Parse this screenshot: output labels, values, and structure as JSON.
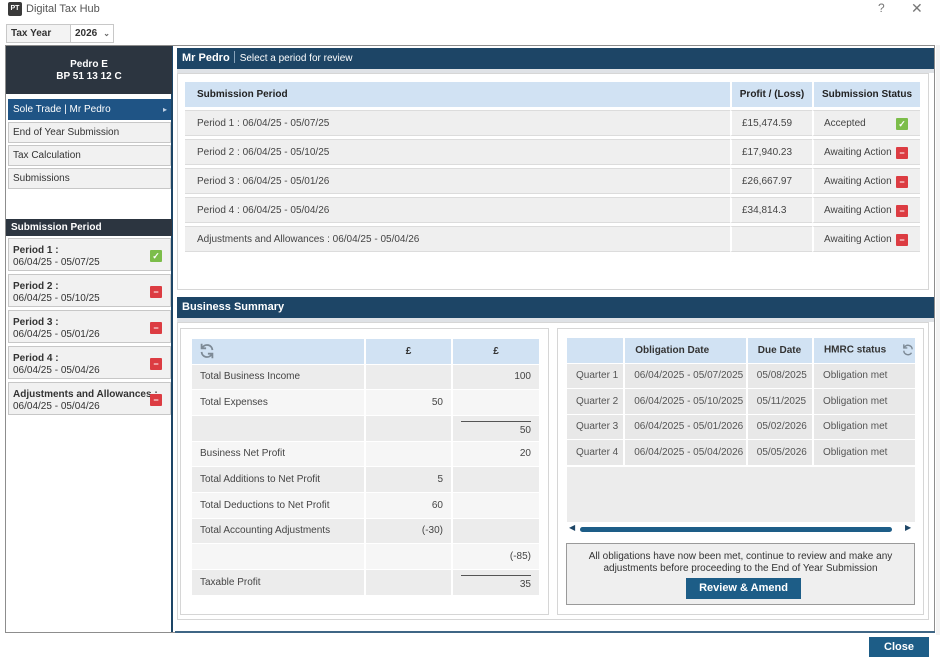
{
  "window": {
    "logo_text": "PT",
    "title": "Digital Tax Hub",
    "help": "?",
    "close": "✕"
  },
  "tax_year": {
    "label": "Tax Year",
    "value": "2026"
  },
  "client": {
    "name": "Pedro E",
    "ref": "BP 51 13 12 C"
  },
  "nav": [
    {
      "label": "Sole Trade | Mr Pedro",
      "active": true
    },
    {
      "label": "End of Year Submission"
    },
    {
      "label": "Tax Calculation"
    },
    {
      "label": "Submissions"
    }
  ],
  "side_periods": {
    "title": "Submission Period",
    "items": [
      {
        "name": "Period 1 :",
        "dates": "06/04/25  -  05/07/25",
        "status": "ok"
      },
      {
        "name": "Period 2 :",
        "dates": "06/04/25  -  05/10/25",
        "status": "no"
      },
      {
        "name": "Period 3 :",
        "dates": "06/04/25  -  05/01/26",
        "status": "no"
      },
      {
        "name": "Period 4 :",
        "dates": "06/04/25  -  05/04/26",
        "status": "no"
      },
      {
        "name": "Adjustments and Allowances :",
        "dates": "06/04/25  -  05/04/26",
        "status": "no"
      }
    ]
  },
  "header": {
    "name": "Mr Pedro",
    "subtitle": "Select a period for review"
  },
  "submissions": {
    "columns": [
      "Submission Period",
      "Profit / (Loss)",
      "Submission Status"
    ],
    "rows": [
      {
        "period": "Period 1 :  06/04/25  -  05/07/25",
        "profit": "£15,474.59",
        "status": "Accepted",
        "ok": true
      },
      {
        "period": "Period 2 :  06/04/25  -  05/10/25",
        "profit": "£17,940.23",
        "status": "Awaiting Action",
        "ok": false
      },
      {
        "period": "Period 3 :  06/04/25  -  05/01/26",
        "profit": "£26,667.97",
        "status": "Awaiting Action",
        "ok": false
      },
      {
        "period": "Period 4 :  06/04/25  -  05/04/26",
        "profit": "£34,814.3",
        "status": "Awaiting Action",
        "ok": false
      },
      {
        "period": "Adjustments and Allowances :  06/04/25  -  05/04/26",
        "profit": "",
        "status": "Awaiting Action",
        "ok": false
      }
    ]
  },
  "business_summary": {
    "title": "Business Summary",
    "col_headers": [
      "£",
      "£"
    ],
    "rows": [
      {
        "label": "Total Business Income",
        "a": "",
        "b": "100"
      },
      {
        "label": "Total Expenses",
        "a": "50",
        "b": ""
      },
      {
        "label": "",
        "a": "",
        "b": "50",
        "b_underline": true
      },
      {
        "label": "Business Net Profit",
        "a": "",
        "b": "20"
      },
      {
        "label": "Total Additions to Net Profit",
        "a": "5",
        "b": ""
      },
      {
        "label": "Total Deductions to Net Profit",
        "a": "60",
        "b": ""
      },
      {
        "label": "Total Accounting Adjustments",
        "a": "(-30)",
        "b": ""
      },
      {
        "label": "",
        "a": "",
        "b": "(-85)"
      },
      {
        "label": "Taxable Profit",
        "a": "",
        "b": "35",
        "b_underline": true
      }
    ]
  },
  "obligations": {
    "columns": [
      "",
      "Obligation Date",
      "Due Date",
      "HMRC status"
    ],
    "rows": [
      {
        "q": "Quarter 1",
        "obligation": "06/04/2025 - 05/07/2025",
        "due": "05/08/2025",
        "status": "Obligation met"
      },
      {
        "q": "Quarter 2",
        "obligation": "06/04/2025 - 05/10/2025",
        "due": "05/11/2025",
        "status": "Obligation met"
      },
      {
        "q": "Quarter 3",
        "obligation": "06/04/2025 - 05/01/2026",
        "due": "05/02/2026",
        "status": "Obligation met"
      },
      {
        "q": "Quarter 4",
        "obligation": "06/04/2025 - 05/04/2026",
        "due": "05/05/2026",
        "status": "Obligation met"
      }
    ],
    "message": "All obligations have now been met, continue to review and make any adjustments before proceeding to the End of Year Submission",
    "review_button": "Review & Amend"
  },
  "footer": {
    "close_button": "Close"
  },
  "colors": {
    "navy": "#1d4566",
    "accent": "#1d5d87",
    "ok": "#7cbd4a",
    "error": "#dc3c42",
    "header_blue": "#d1e2f3"
  }
}
